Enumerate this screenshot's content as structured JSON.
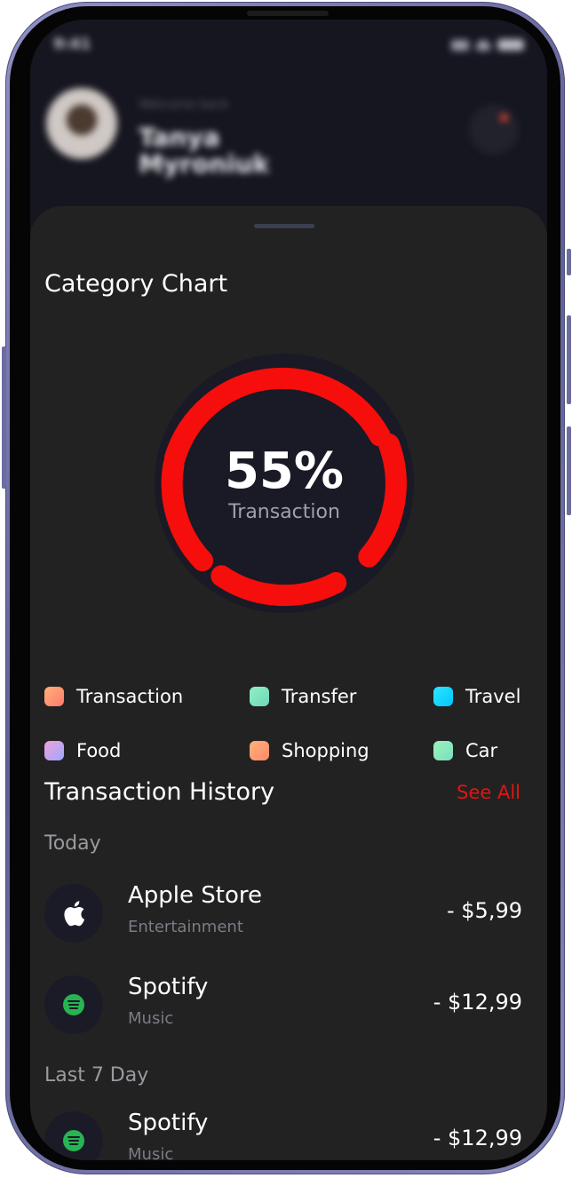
{
  "status_bar": {
    "time": "9:41"
  },
  "header": {
    "welcome": "Welcome back",
    "user_name": "Tanya Myroniuk"
  },
  "category_chart": {
    "title": "Category Chart",
    "center_value": "55%",
    "center_label": "Transaction",
    "ring_color": "#f50e0b"
  },
  "legend": [
    {
      "label": "Transaction",
      "color_from": "#ffb07a",
      "color_to": "#ff7b6b"
    },
    {
      "label": "Transfer",
      "color_from": "#8ff0c4",
      "color_to": "#6fd6b8"
    },
    {
      "label": "Travel",
      "color_from": "#2ee6ff",
      "color_to": "#00c6ff"
    },
    {
      "label": "Food",
      "color_from": "#f0a0d8",
      "color_to": "#9ea8ff"
    },
    {
      "label": "Shopping",
      "color_from": "#ffb07a",
      "color_to": "#ff8a6b"
    },
    {
      "label": "Car",
      "color_from": "#9cf2b8",
      "color_to": "#79e0c0"
    }
  ],
  "history": {
    "title": "Transaction History",
    "see_all": "See All",
    "groups": [
      {
        "label": "Today",
        "items": [
          {
            "name": "Apple Store",
            "category": "Entertainment",
            "amount": "- $5,99",
            "icon": "apple-icon"
          },
          {
            "name": "Spotify",
            "category": "Music",
            "amount": "- $12,99",
            "icon": "spotify-icon"
          }
        ]
      },
      {
        "label": "Last 7 Day",
        "items": [
          {
            "name": "Spotify",
            "category": "Music",
            "amount": "- $12,99",
            "icon": "spotify-icon"
          }
        ]
      }
    ]
  }
}
